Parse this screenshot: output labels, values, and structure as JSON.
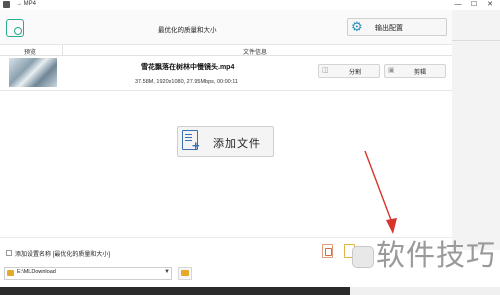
{
  "titlebar": {
    "title": "→ MP4",
    "minimize": "—",
    "maximize": "☐",
    "close": "✕"
  },
  "header": {
    "preset_label": "最优化的质量和大小",
    "output_button_label": "输出配置"
  },
  "table": {
    "columns": [
      "预览",
      "文件信息"
    ],
    "rows": [
      {
        "file_name": "雪花飘落在树林中慢镜头.mp4",
        "meta": "37.58M, 1920x1080, 27.95Mbps, 00:00:11",
        "split_label": "分割",
        "edit_label": "剪辑"
      }
    ]
  },
  "add_files": {
    "label": "添加文件"
  },
  "bottom": {
    "checkbox_label": "添加设置名称 [最优化的质量和大小]",
    "checkbox_checked": false,
    "output_path": "E:\\MLDownload",
    "dropdown_glyph": "▼"
  },
  "watermark": {
    "text": "软件技巧"
  },
  "colors": {
    "accent_teal": "#2aa890",
    "accent_blue": "#3a6fb0",
    "annotation_red": "#d9342b",
    "folder_yellow": "#e6a82a"
  }
}
